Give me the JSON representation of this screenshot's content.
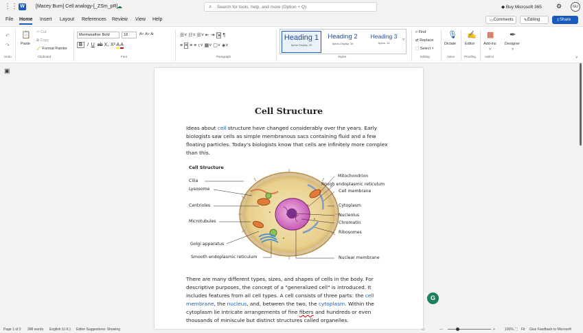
{
  "titlebar": {
    "doc_title": "[Macey Burn] Cell analogy-[_ZSm_pR]",
    "search_placeholder": "Search for tools, help, and more (Option + Q)",
    "buy": "Buy Microsoft 365",
    "avatar": "GU"
  },
  "tabs": {
    "items": [
      "File",
      "Home",
      "Insert",
      "Layout",
      "References",
      "Review",
      "View",
      "Help"
    ],
    "comments": "Comments",
    "editing": "Editing",
    "share": "Share"
  },
  "ribbon": {
    "undo_group": "Undo",
    "paste": "Paste",
    "cut": "Cut",
    "copy": "Copy",
    "format_painter": "Format Painter",
    "clipboard_group": "Clipboard",
    "font_name": "Merriweather Bold",
    "font_size": "18",
    "font_group": "Font",
    "paragraph_group": "Paragraph",
    "styles": [
      {
        "name": "Heading 1",
        "sub": "Aptos Display, 20"
      },
      {
        "name": "Heading 2",
        "sub": "Aptos Display, 16"
      },
      {
        "name": "Heading 3",
        "sub": "Aptos, 14"
      }
    ],
    "styles_group": "Styles",
    "find": "Find",
    "replace": "Replace",
    "select": "Select",
    "editing_group": "Editing",
    "dictate": "Dictate",
    "voice_group": "Voice",
    "editor": "Editor",
    "proofing_group": "Proofing",
    "addins": "Add-ins",
    "addin_group": "Add-in",
    "designer": "Designer"
  },
  "document": {
    "heading": "Cell Structure",
    "para1": {
      "t1": "Ideas about ",
      "l1": "cell",
      "t2": " structure have changed considerably over the years. Early biologists saw cells as simple membranous sacs containing fluid and a few floating particles. Today's biologists know that cells are infinitely more complex than this."
    },
    "figure": {
      "title": "Cell Structure",
      "left_labels": [
        "Cilia",
        "Lysosome",
        "Centrioles",
        "Microtubules",
        "Golgi apparatus",
        "Smooth endoplasmic reticulum"
      ],
      "right_labels": [
        "Mitochondrion",
        "Rough endoplasmic reticulum",
        "Cell membrane",
        "Cytoplasm",
        "Nucleolus",
        "Chromatin",
        "Ribosomes",
        "Nuclear membrane"
      ]
    },
    "para2": {
      "t1": "There are many different types, sizes, and shapes of cells in the body. For descriptive purposes, the concept of a \"generalized cell\" is introduced. It includes features from all cell types. A cell consists of three parts: the ",
      "l1": "cell membrane",
      "t2": ", the ",
      "l2": "nucleus",
      "t3": ", and, between the two, the ",
      "l3": "cytoplasm",
      "t4": ". Within the cytoplasm lie intricate arrangements of fine ",
      "e1": "fibers",
      "t5": " and hundreds or even thousands of miniscule but distinct structures called organelles."
    }
  },
  "grammarly": "G",
  "status": {
    "page": "Page 1 of 2",
    "words": "398 words",
    "lang": "English (U.K.)",
    "suggest": "Editor Suggestions: Showing",
    "zoom": "100%",
    "fit": "Fit",
    "feedback": "Give Feedback to Microsoft"
  },
  "colors": {
    "accent": "#185abd",
    "link": "#1a5fb4",
    "grammarly": "#1d7f5c"
  }
}
